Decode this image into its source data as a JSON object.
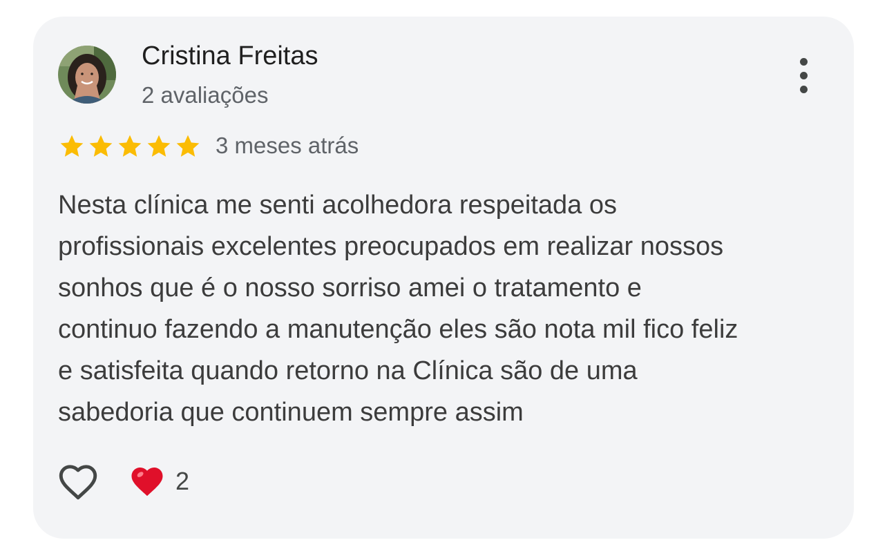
{
  "review": {
    "author_name": "Cristina Freitas",
    "review_count": "2 avaliações",
    "rating": 5,
    "max_rating": 5,
    "time": "3 meses atrás",
    "text_lines": [
      "Nesta clínica me senti acolhedora respeitada os",
      "profissionais excelentes preocupados em realizar nossos",
      "sonhos que é o nosso sorriso amei o tratamento e",
      "continuo fazendo a manutenção eles são nota mil fico feliz",
      "e satisfeita quando retorno na Clínica são de uma",
      "sabedoria que continuem sempre assim"
    ],
    "reaction_count": "2"
  },
  "colors": {
    "card_background": "#f3f4f6",
    "star": "#fbbc04",
    "heart_reaction": "#e0102a",
    "icon": "#444746"
  },
  "icons": {
    "avatar": "avatar-photo",
    "more": "more-vert-icon",
    "star": "star-icon",
    "like": "heart-outline-icon",
    "reaction": "heart-emoji-icon"
  }
}
